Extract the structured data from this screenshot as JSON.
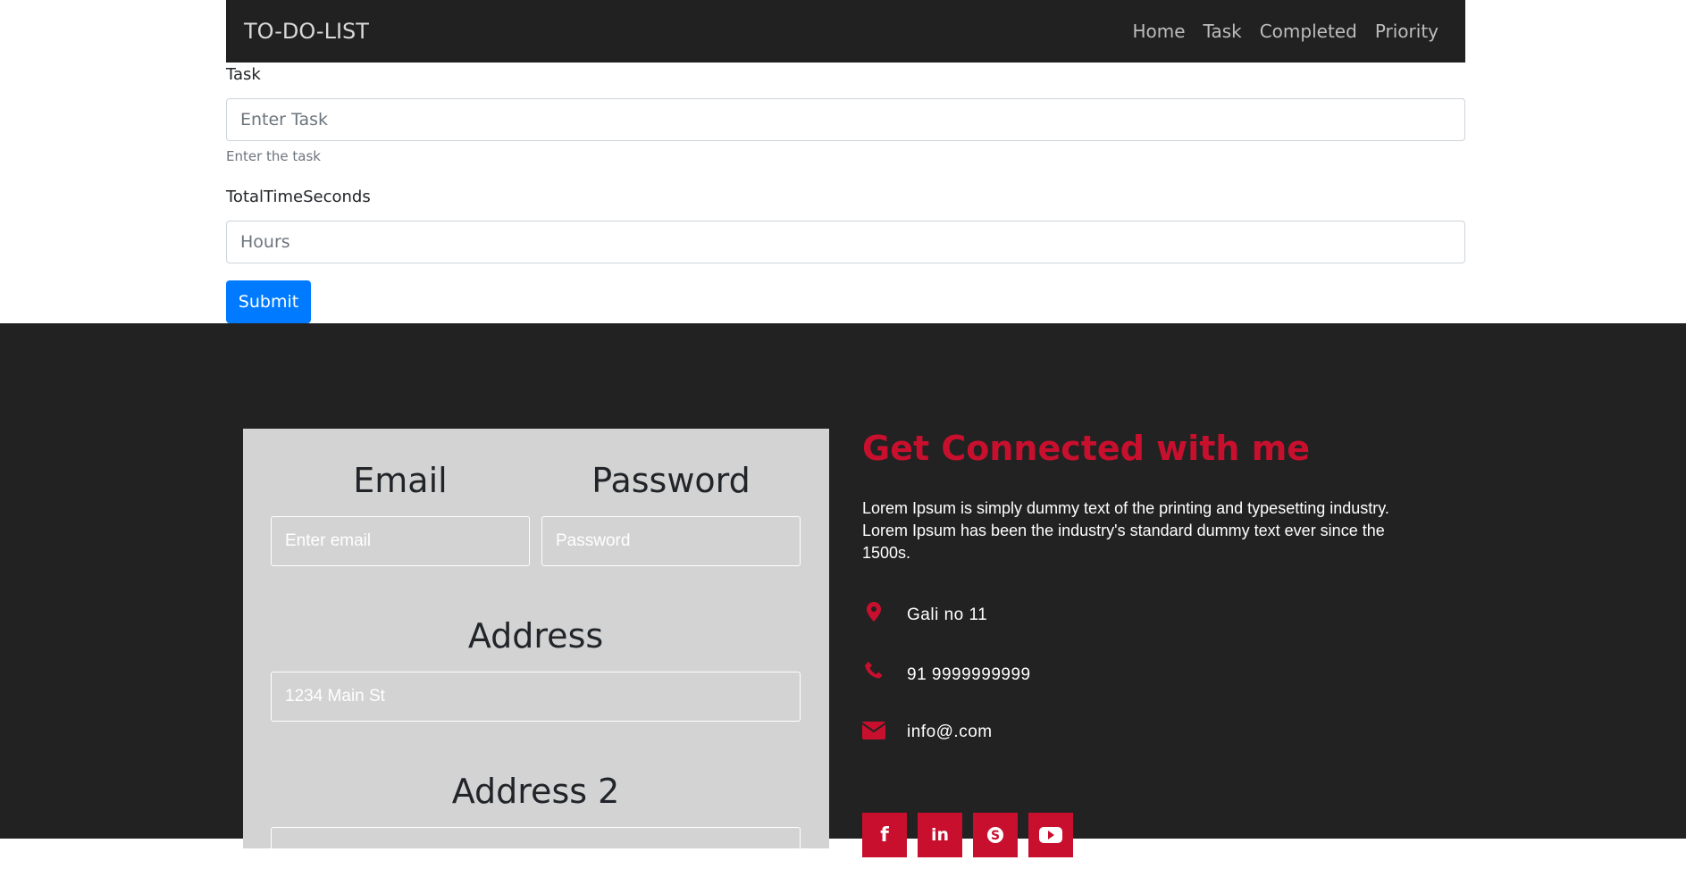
{
  "navbar": {
    "brand": "TO-DO-LIST",
    "links": [
      "Home",
      "Task",
      "Completed",
      "Priority"
    ]
  },
  "task_form": {
    "task_label": "Task",
    "task_placeholder": "Enter Task",
    "task_help": "Enter the task",
    "time_label": "TotalTimeSeconds",
    "time_placeholder": "Hours",
    "submit_label": "Submit"
  },
  "login_card": {
    "email_heading": "Email",
    "email_placeholder": "Enter email",
    "password_heading": "Password",
    "password_placeholder": "Password",
    "address_heading": "Address",
    "address_placeholder": "1234 Main St",
    "address2_heading": "Address 2"
  },
  "contact": {
    "title": "Get Connected with me",
    "description": "Lorem Ipsum is simply dummy text of the printing and typesetting industry. Lorem Ipsum has been the industry's standard dummy text ever since the 1500s.",
    "items": [
      {
        "icon": "map-marker-icon",
        "text": "Gali no 11"
      },
      {
        "icon": "phone-icon",
        "text": "91 9999999999"
      },
      {
        "icon": "envelope-icon",
        "text": "info@.com"
      }
    ],
    "social": [
      "facebook-icon",
      "linkedin-icon",
      "skype-icon",
      "youtube-icon"
    ]
  },
  "colors": {
    "navbar_bg": "#212121",
    "footer_bg": "#222222",
    "accent_red": "#c8102e",
    "primary_blue": "#007bff",
    "card_bg": "#d3d3d3"
  }
}
